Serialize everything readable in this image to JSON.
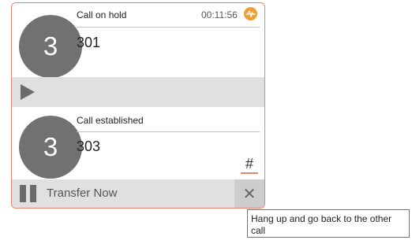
{
  "call_held": {
    "avatar_label": "3",
    "status": "Call on hold",
    "timer": "00:11:56",
    "number": "301"
  },
  "call_active": {
    "avatar_label": "3",
    "status": "Call established",
    "number": "303",
    "dtmf_label": "#"
  },
  "actions": {
    "resume_icon": "play-icon",
    "hold_icon": "pause-icon",
    "transfer_label": "Transfer Now",
    "close_label": "✕"
  },
  "tooltip": {
    "text": "Hang up and go back to the other call"
  },
  "colors": {
    "accent": "#e8826a",
    "hold_badge": "#f0a030",
    "avatar": "#717171",
    "bar": "#e0e0e0"
  }
}
